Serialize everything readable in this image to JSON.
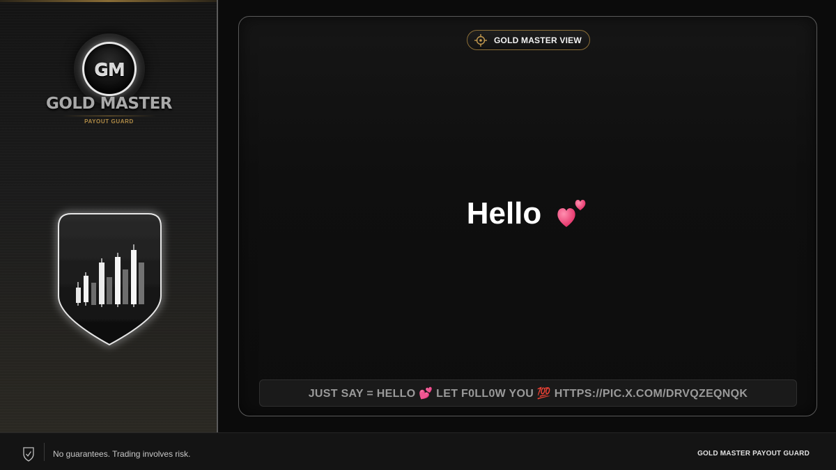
{
  "brand": {
    "monogram": "GM",
    "title": "GOLD MASTER",
    "subtitle": "PAYOUT GUARD"
  },
  "panel": {
    "badge_label": "GOLD MASTER VIEW",
    "headline": "Hello",
    "marquee": "JUST SAY = HELLO 💕 LET F0LL0W YOU 💯 HTTPS://PIC.X.COM/DRVQZEQNQK"
  },
  "footer": {
    "disclaimer": "No guarantees. Trading involves risk.",
    "brand": "GOLD MASTER PAYOUT GUARD"
  },
  "icons": {
    "logo": "gm-monogram-icon",
    "shield": "shield-candlestick-icon",
    "badge": "crosshair-icon",
    "headline": "two-hearts-icon",
    "footer": "shield-check-icon"
  },
  "colors": {
    "accent_gold": "#b08b46",
    "background": "#0b0b0b",
    "text_muted": "#9a9a9a"
  }
}
